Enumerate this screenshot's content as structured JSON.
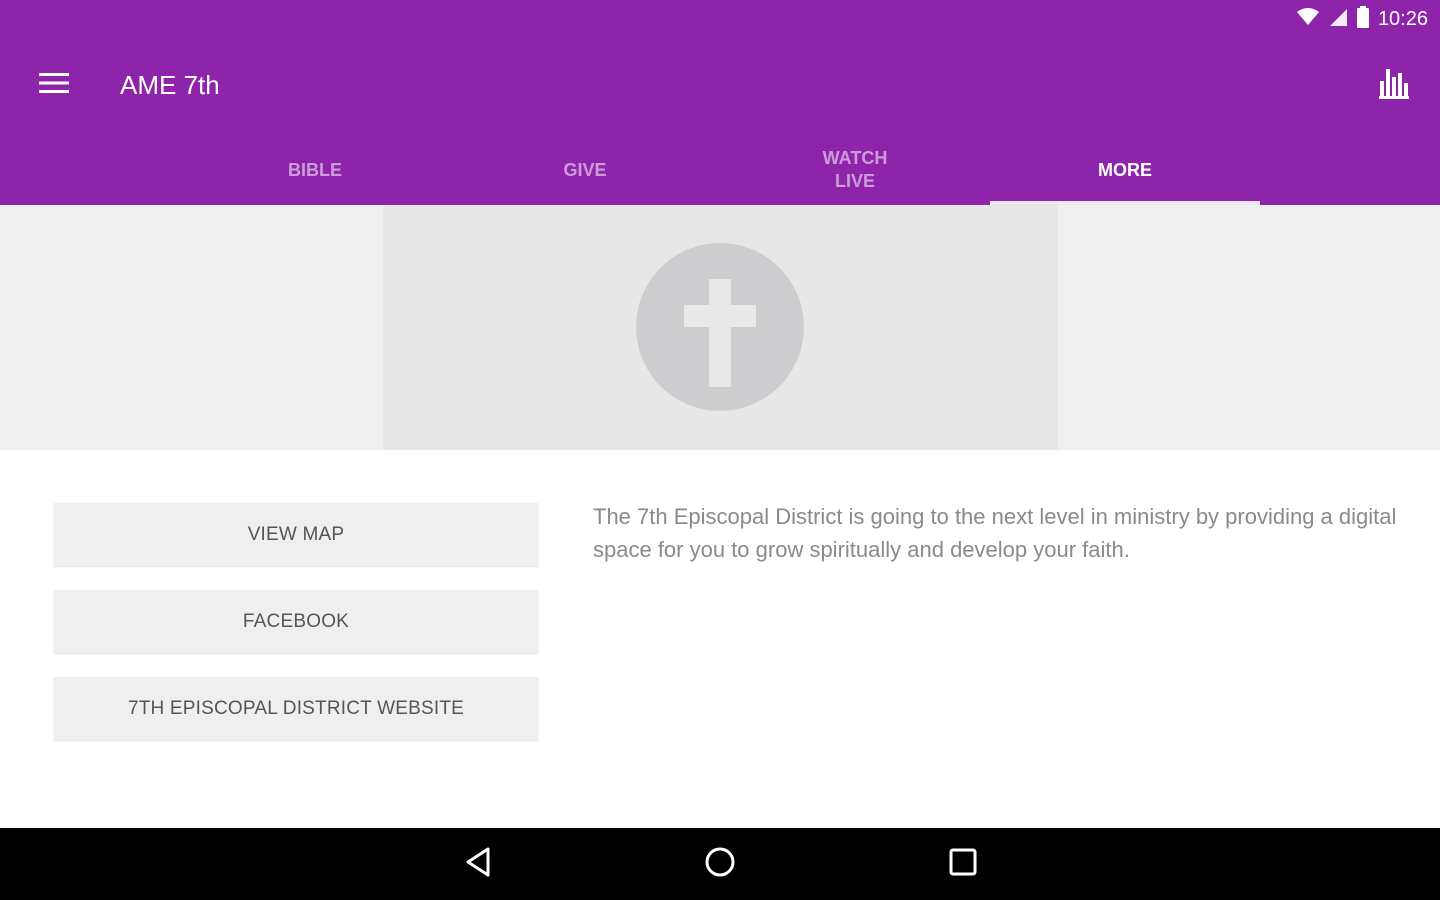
{
  "status_bar": {
    "time": "10:26",
    "icons": [
      "wifi-icon",
      "signal-icon",
      "battery-icon"
    ]
  },
  "toolbar": {
    "title": "AME 7th",
    "menu_icon": "hamburger-menu-icon",
    "action_icon": "bar-chart-icon"
  },
  "tabs": [
    {
      "label": "BIBLE",
      "active": false
    },
    {
      "label": "GIVE",
      "active": false
    },
    {
      "label": "WATCH\nLIVE",
      "active": false
    },
    {
      "label": "MORE",
      "active": true
    }
  ],
  "hero": {
    "icon": "cross-icon"
  },
  "actions": {
    "view_map": "VIEW MAP",
    "facebook": "FACEBOOK",
    "website": "7TH EPISCOPAL DISTRICT WEBSITE"
  },
  "description": "The 7th Episcopal District is going to the next level in ministry by providing a digital space for you to grow spiritually and develop your faith.",
  "navigation": {
    "icons": [
      "back-icon",
      "home-icon",
      "recents-icon"
    ]
  },
  "colors": {
    "primary": "#8e24aa",
    "tab_indicator": "#f0e6f3",
    "hero_background": "#efefef",
    "button_background": "#efefef",
    "description_text": "#8a8a8a"
  }
}
